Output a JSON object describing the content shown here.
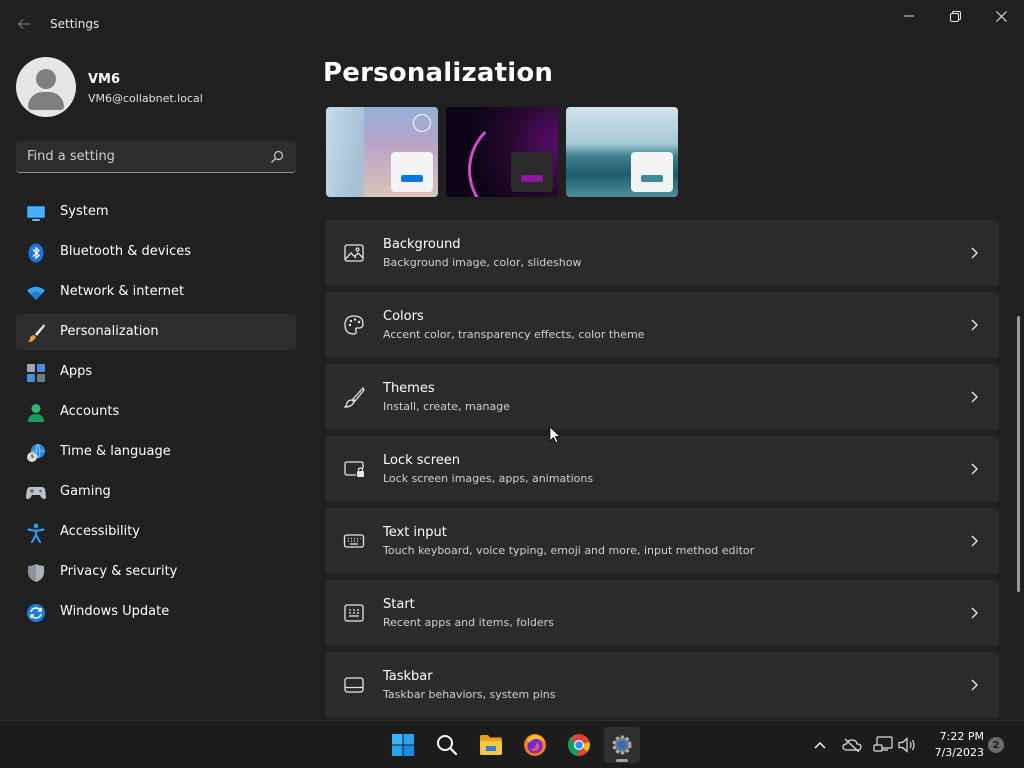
{
  "window": {
    "title": "Settings"
  },
  "profile": {
    "name": "VM6",
    "email": "VM6@collabnet.local"
  },
  "search": {
    "placeholder": "Find a setting"
  },
  "sidebar": {
    "items": [
      {
        "label": "System",
        "icon": "system-icon"
      },
      {
        "label": "Bluetooth & devices",
        "icon": "bluetooth-icon"
      },
      {
        "label": "Network & internet",
        "icon": "wifi-icon"
      },
      {
        "label": "Personalization",
        "icon": "brush-icon",
        "selected": true
      },
      {
        "label": "Apps",
        "icon": "apps-icon"
      },
      {
        "label": "Accounts",
        "icon": "person-icon"
      },
      {
        "label": "Time & language",
        "icon": "clock-globe-icon"
      },
      {
        "label": "Gaming",
        "icon": "gamepad-icon"
      },
      {
        "label": "Accessibility",
        "icon": "accessibility-icon"
      },
      {
        "label": "Privacy & security",
        "icon": "shield-icon"
      },
      {
        "label": "Windows Update",
        "icon": "update-icon"
      }
    ]
  },
  "main": {
    "title": "Personalization",
    "settings": [
      {
        "title": "Background",
        "subtitle": "Background image, color, slideshow",
        "icon": "image-icon"
      },
      {
        "title": "Colors",
        "subtitle": "Accent color, transparency effects, color theme",
        "icon": "palette-icon"
      },
      {
        "title": "Themes",
        "subtitle": "Install, create, manage",
        "icon": "brush-icon"
      },
      {
        "title": "Lock screen",
        "subtitle": "Lock screen images, apps, animations",
        "icon": "lock-screen-icon"
      },
      {
        "title": "Text input",
        "subtitle": "Touch keyboard, voice typing, emoji and more, input method editor",
        "icon": "keyboard-icon"
      },
      {
        "title": "Start",
        "subtitle": "Recent apps and items, folders",
        "icon": "start-icon"
      },
      {
        "title": "Taskbar",
        "subtitle": "Taskbar behaviors, system pins",
        "icon": "taskbar-icon"
      }
    ]
  },
  "taskbar": {
    "time": "7:22 PM",
    "date": "7/3/2023",
    "notification_count": "2"
  },
  "colors": {
    "background": "#202020",
    "card": "#2b2b2b",
    "accent": "#0078d4"
  }
}
